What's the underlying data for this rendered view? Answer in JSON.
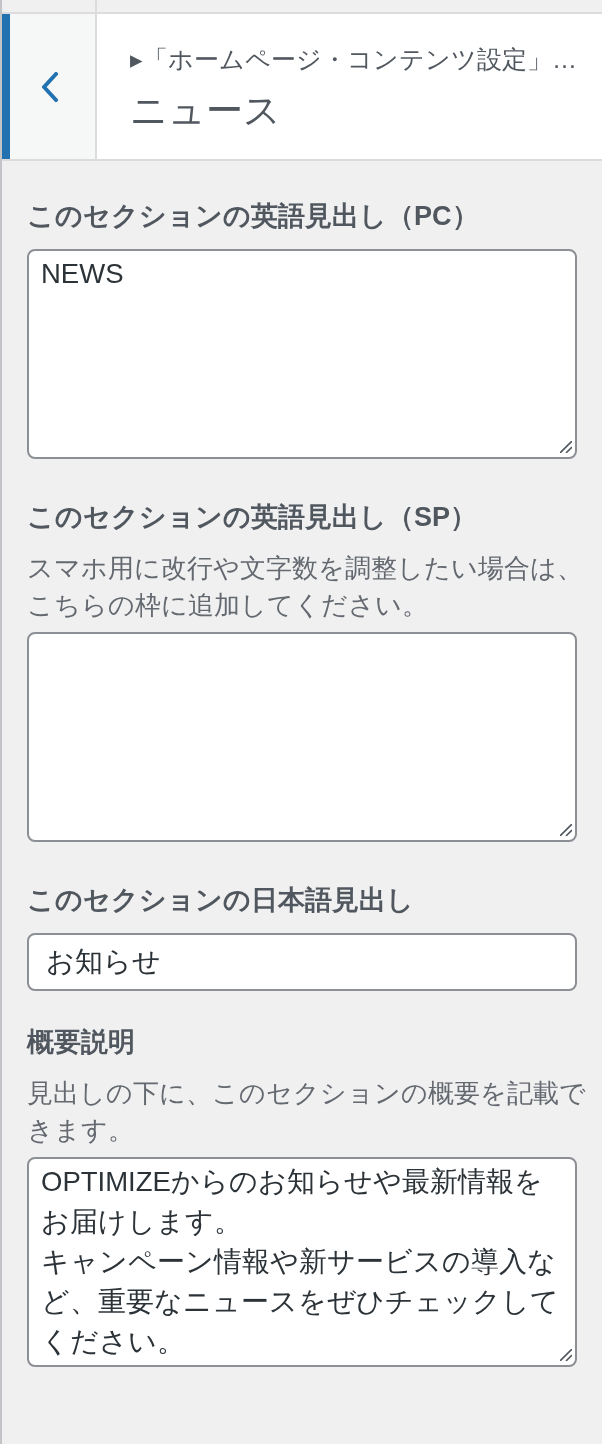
{
  "header": {
    "breadcrumb": "▸「ホームページ・コンテンツ設定」…",
    "title": "ニュース"
  },
  "controls": [
    {
      "kind": "textarea",
      "label": "このセクションの英語見出し（PC）",
      "value": [
        "NEWS"
      ]
    },
    {
      "kind": "textarea",
      "label": "このセクションの英語見出し（SP）",
      "description": "スマホ用に改行や文字数を調整したい場合は、こちらの枠に追加してください。"
    },
    {
      "kind": "text",
      "label": "このセクションの日本語見出し",
      "value": "お知らせ"
    },
    {
      "kind": "textarea",
      "label": "概要説明",
      "description": "見出しの下に、このセクションの概要を記載できます。",
      "value": [
        "OPTIMIZEからのお知らせや最新情報をお届けします。",
        "キャンペーン情報や新サービスの導入など、重要なニュースをぜひチェックしてください。"
      ]
    }
  ]
}
